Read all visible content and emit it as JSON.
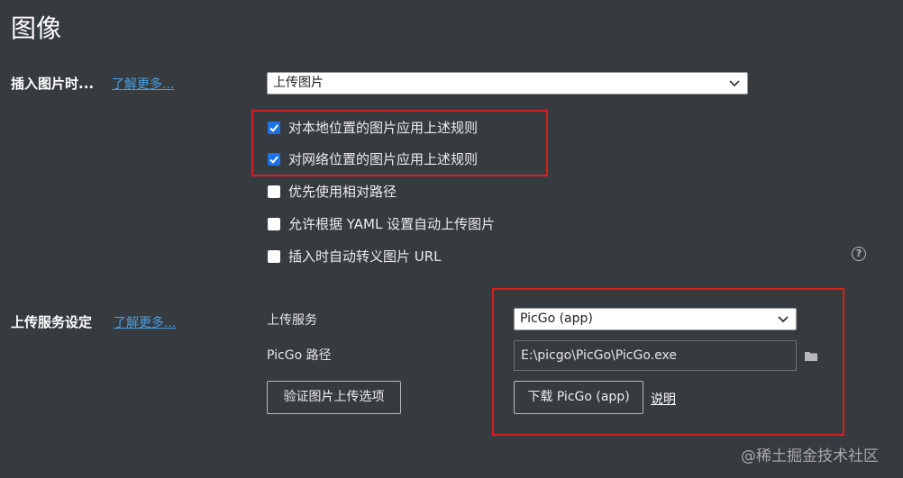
{
  "page": {
    "title": "图像"
  },
  "insert": {
    "label": "插入图片时...",
    "learn_more": "了解更多...",
    "selected": "上传图片",
    "checkboxes": [
      {
        "label": "对本地位置的图片应用上述规则",
        "checked": true
      },
      {
        "label": "对网络位置的图片应用上述规则",
        "checked": true
      },
      {
        "label": "优先使用相对路径",
        "checked": false
      },
      {
        "label": "允许根据 YAML 设置自动上传图片",
        "checked": false
      },
      {
        "label": "插入时自动转义图片 URL",
        "checked": false
      }
    ],
    "help_glyph": "?"
  },
  "upload": {
    "label": "上传服务设定",
    "learn_more": "了解更多...",
    "service_label": "上传服务",
    "service_selected": "PicGo (app)",
    "path_label": "PicGo 路径",
    "path_value": "E:\\picgo\\PicGo\\PicGo.exe",
    "validate_button": "验证图片上传选项",
    "download_button": "下载 PicGo (app)",
    "explain_link": "说明"
  },
  "watermark": "@稀土掘金技术社区",
  "icons": {
    "folder": "folder-icon",
    "chevron": "chevron-down-icon",
    "check": "checkmark-icon",
    "help": "help-icon"
  },
  "colors": {
    "background": "#363b40",
    "highlight_border": "#d81f1f",
    "checkbox_on": "#1a73e8",
    "link": "#4a9ee0"
  }
}
